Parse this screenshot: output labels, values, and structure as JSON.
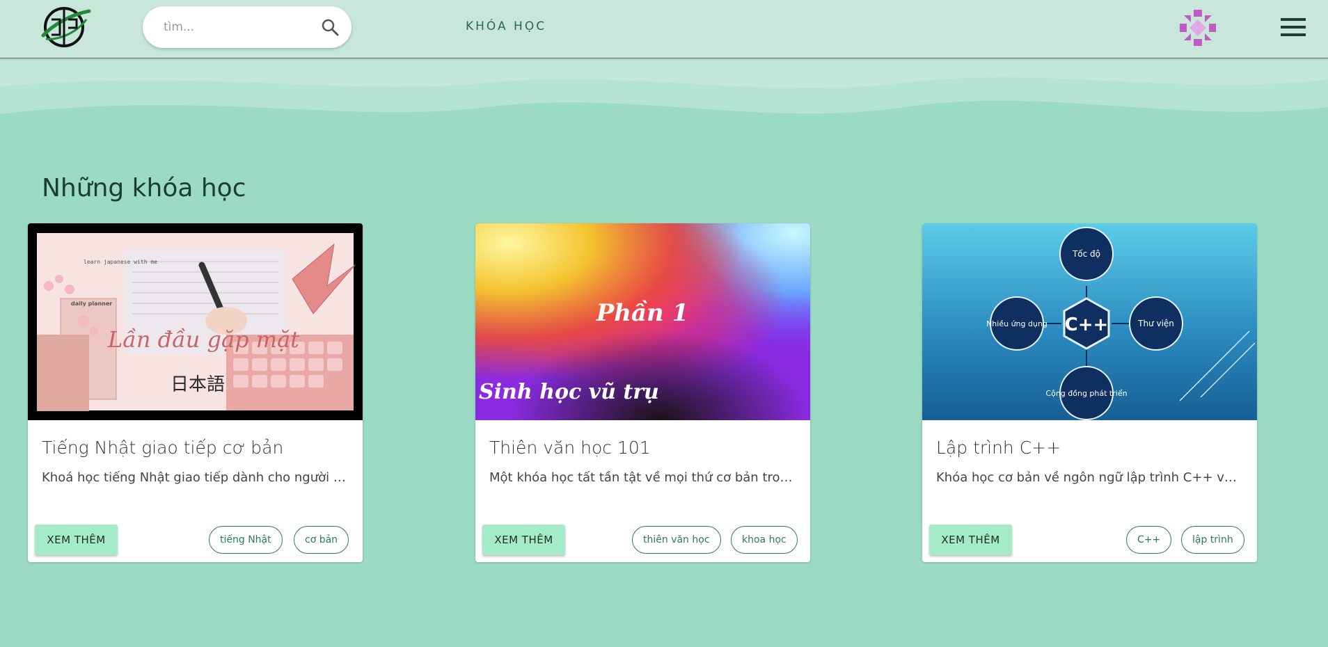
{
  "header": {
    "search_placeholder": "tìm...",
    "nav_link": "KHÓA HỌC"
  },
  "colors": {
    "header_bg": "#c8e6da",
    "page_bg": "#9bdbc3",
    "button_bg": "#a4ecc8",
    "tag_border": "#2c7a5e"
  },
  "icons": {
    "logo": "site-logo",
    "search": "search-icon",
    "avatar": "avatar-pattern-icon",
    "menu": "hamburger-menu-icon"
  },
  "section_title": "Những khóa học",
  "courses": [
    {
      "title": "Tiếng Nhật giao tiếp cơ bản",
      "description": "Khoá học tiếng Nhật giao tiếp dành cho người mới bắt đầu",
      "button": "XEM THÊM",
      "tags": [
        "tiếng Nhật",
        "cơ bản"
      ],
      "image_text": {
        "header": "learn japanese with me",
        "planner": "daily planner",
        "script": "Lần đầu gặp mặt",
        "kanji": "日本語"
      }
    },
    {
      "title": "Thiên văn học 101",
      "description": "Một khóa học tất tần tật về mọi thứ cơ bản trong thiên văn học",
      "button": "XEM THÊM",
      "tags": [
        "thiên văn học",
        "khoa học"
      ],
      "image_text": {
        "part": "Phần 1",
        "subtitle": "Sinh học vũ trụ"
      }
    },
    {
      "title": "Lập trình C++",
      "description": "Khóa học cơ bản về ngôn ngữ lập trình C++ và một số ứng dụng",
      "button": "XEM THÊM",
      "tags": [
        "C++",
        "lập trình"
      ],
      "image_text": {
        "center": "C++",
        "top": "Tốc độ",
        "left": "Nhiều ứng dụng",
        "right": "Thư viện",
        "bottom": "Cộng đồng phát triển"
      }
    }
  ]
}
